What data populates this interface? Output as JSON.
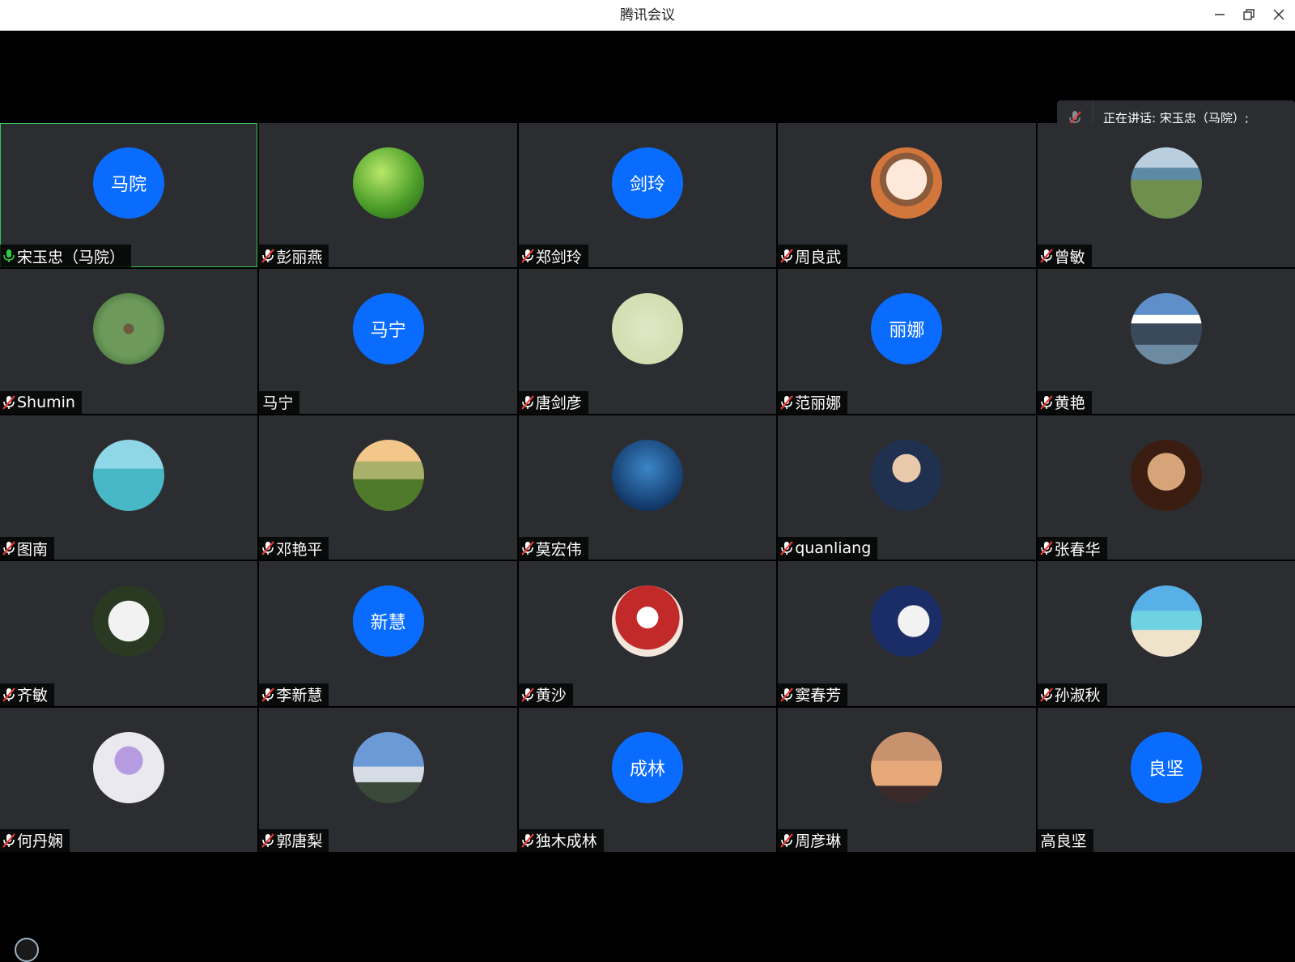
{
  "window": {
    "title": "腾讯会议",
    "controls": [
      "minimize-icon",
      "restore-icon",
      "close-icon"
    ]
  },
  "speaking": {
    "text": "正在讲话: 宋玉忠（马院）;",
    "icon": "mic-muted-icon"
  },
  "colors": {
    "avatar_blue": "#0a6cff",
    "tile_bg": "#2b2d31",
    "active_border": "#32c55a",
    "mic_active": "#2ecc40",
    "mic_muted": "#e53935"
  },
  "participants": [
    {
      "name": "宋玉忠（马院）",
      "avatar_text": "马院",
      "mic": "on",
      "active": true
    },
    {
      "name": "彭丽燕",
      "avatar_image": "green-leaves",
      "mic": "muted"
    },
    {
      "name": "郑剑玲",
      "avatar_text": "剑玲",
      "mic": "muted"
    },
    {
      "name": "周良武",
      "avatar_image": "cartoon-man-glasses",
      "mic": "muted"
    },
    {
      "name": "曾敏",
      "avatar_image": "lake-landscape",
      "mic": "muted"
    },
    {
      "name": "Shumin",
      "avatar_image": "tree-trunk",
      "mic": "muted"
    },
    {
      "name": "马宁",
      "avatar_text": "马宁",
      "mic": "none"
    },
    {
      "name": "唐剑彦",
      "avatar_image": "pale-green-card",
      "mic": "muted"
    },
    {
      "name": "范丽娜",
      "avatar_text": "丽娜",
      "mic": "muted"
    },
    {
      "name": "黄艳",
      "avatar_image": "mountain-lake",
      "mic": "muted"
    },
    {
      "name": "图南",
      "avatar_image": "turquoise-sea",
      "mic": "muted"
    },
    {
      "name": "邓艳平",
      "avatar_image": "green-hills",
      "mic": "muted"
    },
    {
      "name": "莫宏伟",
      "avatar_image": "starry-sky",
      "mic": "muted"
    },
    {
      "name": "quanliang",
      "avatar_image": "boy-portrait",
      "mic": "muted"
    },
    {
      "name": "张春华",
      "avatar_image": "cat",
      "mic": "muted"
    },
    {
      "name": "齐敏",
      "avatar_image": "white-flowers",
      "mic": "muted"
    },
    {
      "name": "李新慧",
      "avatar_text": "新慧",
      "mic": "muted"
    },
    {
      "name": "黄沙",
      "avatar_image": "girl-red-dress",
      "mic": "muted"
    },
    {
      "name": "窦春芳",
      "avatar_image": "moon",
      "mic": "muted"
    },
    {
      "name": "孙淑秋",
      "avatar_image": "beach-woman",
      "mic": "muted"
    },
    {
      "name": "何丹娴",
      "avatar_image": "purple-flowers",
      "mic": "muted"
    },
    {
      "name": "郭唐梨",
      "avatar_image": "snowy-village",
      "mic": "muted"
    },
    {
      "name": "独木成林",
      "avatar_text": "成林",
      "mic": "muted"
    },
    {
      "name": "周彦琳",
      "avatar_image": "sunset-clouds",
      "mic": "muted"
    },
    {
      "name": "高良坚",
      "avatar_text": "良坚",
      "mic": "none"
    }
  ]
}
